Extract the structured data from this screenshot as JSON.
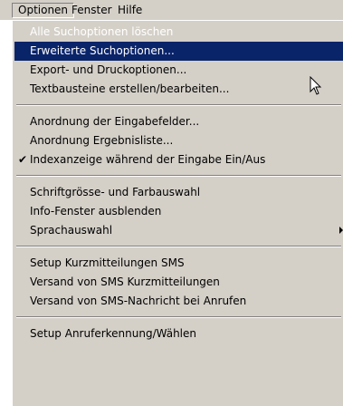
{
  "menubar": {
    "items": [
      {
        "label": "Optionen"
      },
      {
        "label": "Fenster"
      },
      {
        "label": "Hilfe"
      }
    ]
  },
  "menu": {
    "items": [
      {
        "label": "Alle Suchoptionen löschen",
        "state": "disabled"
      },
      {
        "label": "Erweiterte Suchoptionen...",
        "state": "highlighted"
      },
      {
        "label": "Export- und Druckoptionen..."
      },
      {
        "label": "Textbausteine erstellen/bearbeiten..."
      },
      {
        "label": "Anordnung der Eingabefelder..."
      },
      {
        "label": "Anordnung Ergebnisliste..."
      },
      {
        "label": "Indexanzeige während der Eingabe Ein/Aus",
        "checked": true
      },
      {
        "label": "Schriftgrösse- und Farbauswahl"
      },
      {
        "label": "Info-Fenster ausblenden"
      },
      {
        "label": "Sprachauswahl",
        "submenu": true
      },
      {
        "label": "Setup Kurzmitteilungen SMS"
      },
      {
        "label": "Versand von SMS Kurzmitteilungen"
      },
      {
        "label": "Versand von SMS-Nachricht bei Anrufen"
      },
      {
        "label": "Setup Anruferkennung/Wählen"
      }
    ]
  },
  "colors": {
    "menu_background": "#d4d0c8",
    "highlight_background": "#0a246a",
    "highlight_text": "#ffffff",
    "disabled_text": "#ffffff"
  },
  "icons": [
    "check-icon",
    "submenu-arrow-icon",
    "cursor-icon"
  ]
}
